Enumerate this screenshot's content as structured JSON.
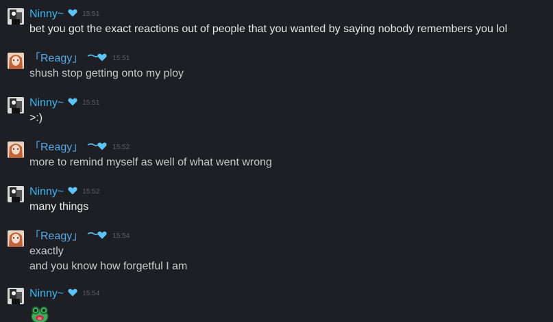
{
  "colors": {
    "background": "#1e1f24",
    "name_ninny": "#3bb6f0",
    "name_reagy": "#55a9e8",
    "timestamp": "#5b6067",
    "text": "#dcdedf"
  },
  "messages": [
    {
      "author": "Ninny~",
      "time": "15:51",
      "lines": [
        "bet you got the exact reactions out of people that you wanted by saying nobody remembers you lol"
      ]
    },
    {
      "author": "「Reagy」",
      "time": "15:51",
      "lines": [
        "shush stop getting onto my ploy"
      ]
    },
    {
      "author": "Ninny~",
      "time": "15:51",
      "lines": [
        ">:)"
      ]
    },
    {
      "author": "「Reagy」",
      "time": "15:52",
      "lines": [
        "more to remind myself as well of what went wrong"
      ]
    },
    {
      "author": "Ninny~",
      "time": "15:52",
      "lines": [
        "many things"
      ]
    },
    {
      "author": "「Reagy」",
      "time": "15:54",
      "lines": [
        "exactly",
        "and you know how forgetful I am"
      ]
    },
    {
      "author": "Ninny~",
      "time": "15:54",
      "emoticon": "green-frog-emoticon"
    }
  ]
}
